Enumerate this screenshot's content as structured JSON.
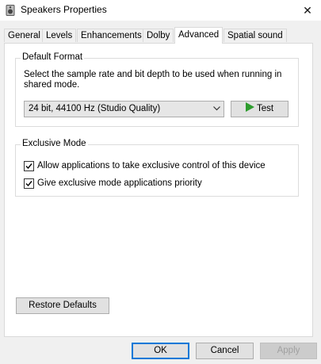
{
  "window": {
    "title": "Speakers Properties",
    "close_glyph": "✕"
  },
  "tabs": [
    {
      "label": "General",
      "active": false
    },
    {
      "label": "Levels",
      "active": false
    },
    {
      "label": "Enhancements",
      "active": false
    },
    {
      "label": "Dolby",
      "active": false
    },
    {
      "label": "Advanced",
      "active": true
    },
    {
      "label": "Spatial sound",
      "active": false
    }
  ],
  "default_format": {
    "heading": "Default Format",
    "description": "Select the sample rate and bit depth to be used when running in shared mode.",
    "selected_format": "24 bit, 44100 Hz (Studio Quality)",
    "test_label": "Test"
  },
  "exclusive_mode": {
    "heading": "Exclusive Mode",
    "options": [
      {
        "label": "Allow applications to take exclusive control of this device",
        "checked": true
      },
      {
        "label": "Give exclusive mode applications priority",
        "checked": true
      }
    ]
  },
  "restore_label": "Restore Defaults",
  "footer": {
    "ok_label": "OK",
    "cancel_label": "Cancel",
    "apply_label": "Apply"
  },
  "colors": {
    "accent": "#0078d7",
    "play_green": "#2d9c2d",
    "dialog_bg": "#f0f0f0"
  }
}
